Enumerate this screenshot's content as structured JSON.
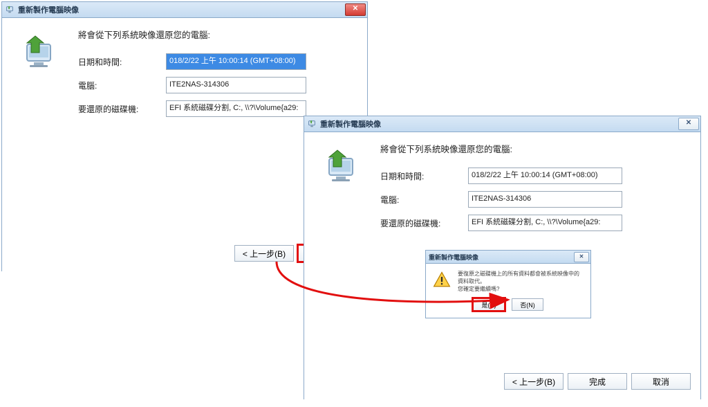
{
  "common": {
    "window_title": "重新製作電腦映像",
    "headline": "將會從下列系統映像還原您的電腦:",
    "labels": {
      "datetime": "日期和時間:",
      "computer": "電腦:",
      "disks": "要還原的磁碟機:"
    },
    "values": {
      "datetime": "018/2/22 上午 10:00:14 (GMT+08:00)",
      "computer": "ITE2NAS-314306",
      "disks": "EFI 系統磁碟分割, C:, \\\\?\\Volume{a29:"
    }
  },
  "buttons": {
    "back": "< 上一步(B)",
    "finish": "完成",
    "cancel": "取消"
  },
  "confirm": {
    "title": "重新製作電腦映像",
    "message_line1": "要復原之磁碟機上的所有資料都會被系統映像中的資料取代。",
    "message_line2": "您確定要繼續嗎?",
    "yes": "是(Y)",
    "no": "否(N)"
  }
}
